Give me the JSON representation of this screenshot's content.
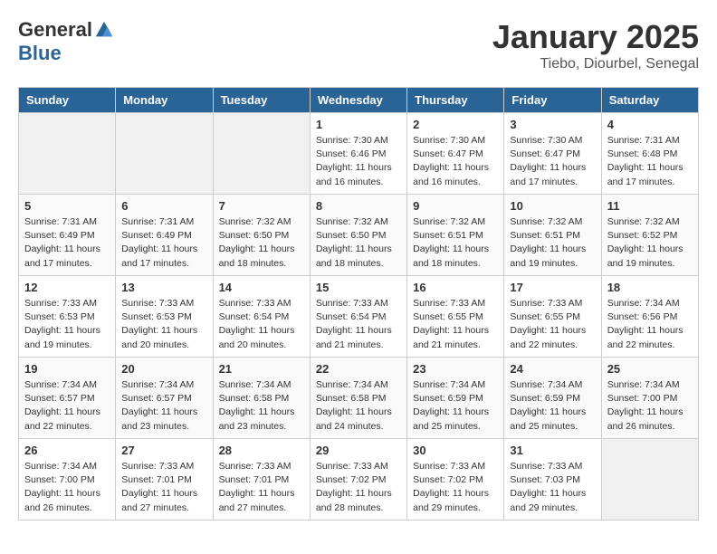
{
  "header": {
    "logo_general": "General",
    "logo_blue": "Blue",
    "title": "January 2025",
    "subtitle": "Tiebo, Diourbel, Senegal"
  },
  "days_of_week": [
    "Sunday",
    "Monday",
    "Tuesday",
    "Wednesday",
    "Thursday",
    "Friday",
    "Saturday"
  ],
  "weeks": [
    [
      {
        "day": "",
        "info": ""
      },
      {
        "day": "",
        "info": ""
      },
      {
        "day": "",
        "info": ""
      },
      {
        "day": "1",
        "info": "Sunrise: 7:30 AM\nSunset: 6:46 PM\nDaylight: 11 hours and 16 minutes."
      },
      {
        "day": "2",
        "info": "Sunrise: 7:30 AM\nSunset: 6:47 PM\nDaylight: 11 hours and 16 minutes."
      },
      {
        "day": "3",
        "info": "Sunrise: 7:30 AM\nSunset: 6:47 PM\nDaylight: 11 hours and 17 minutes."
      },
      {
        "day": "4",
        "info": "Sunrise: 7:31 AM\nSunset: 6:48 PM\nDaylight: 11 hours and 17 minutes."
      }
    ],
    [
      {
        "day": "5",
        "info": "Sunrise: 7:31 AM\nSunset: 6:49 PM\nDaylight: 11 hours and 17 minutes."
      },
      {
        "day": "6",
        "info": "Sunrise: 7:31 AM\nSunset: 6:49 PM\nDaylight: 11 hours and 17 minutes."
      },
      {
        "day": "7",
        "info": "Sunrise: 7:32 AM\nSunset: 6:50 PM\nDaylight: 11 hours and 18 minutes."
      },
      {
        "day": "8",
        "info": "Sunrise: 7:32 AM\nSunset: 6:50 PM\nDaylight: 11 hours and 18 minutes."
      },
      {
        "day": "9",
        "info": "Sunrise: 7:32 AM\nSunset: 6:51 PM\nDaylight: 11 hours and 18 minutes."
      },
      {
        "day": "10",
        "info": "Sunrise: 7:32 AM\nSunset: 6:51 PM\nDaylight: 11 hours and 19 minutes."
      },
      {
        "day": "11",
        "info": "Sunrise: 7:32 AM\nSunset: 6:52 PM\nDaylight: 11 hours and 19 minutes."
      }
    ],
    [
      {
        "day": "12",
        "info": "Sunrise: 7:33 AM\nSunset: 6:53 PM\nDaylight: 11 hours and 19 minutes."
      },
      {
        "day": "13",
        "info": "Sunrise: 7:33 AM\nSunset: 6:53 PM\nDaylight: 11 hours and 20 minutes."
      },
      {
        "day": "14",
        "info": "Sunrise: 7:33 AM\nSunset: 6:54 PM\nDaylight: 11 hours and 20 minutes."
      },
      {
        "day": "15",
        "info": "Sunrise: 7:33 AM\nSunset: 6:54 PM\nDaylight: 11 hours and 21 minutes."
      },
      {
        "day": "16",
        "info": "Sunrise: 7:33 AM\nSunset: 6:55 PM\nDaylight: 11 hours and 21 minutes."
      },
      {
        "day": "17",
        "info": "Sunrise: 7:33 AM\nSunset: 6:55 PM\nDaylight: 11 hours and 22 minutes."
      },
      {
        "day": "18",
        "info": "Sunrise: 7:34 AM\nSunset: 6:56 PM\nDaylight: 11 hours and 22 minutes."
      }
    ],
    [
      {
        "day": "19",
        "info": "Sunrise: 7:34 AM\nSunset: 6:57 PM\nDaylight: 11 hours and 22 minutes."
      },
      {
        "day": "20",
        "info": "Sunrise: 7:34 AM\nSunset: 6:57 PM\nDaylight: 11 hours and 23 minutes."
      },
      {
        "day": "21",
        "info": "Sunrise: 7:34 AM\nSunset: 6:58 PM\nDaylight: 11 hours and 23 minutes."
      },
      {
        "day": "22",
        "info": "Sunrise: 7:34 AM\nSunset: 6:58 PM\nDaylight: 11 hours and 24 minutes."
      },
      {
        "day": "23",
        "info": "Sunrise: 7:34 AM\nSunset: 6:59 PM\nDaylight: 11 hours and 25 minutes."
      },
      {
        "day": "24",
        "info": "Sunrise: 7:34 AM\nSunset: 6:59 PM\nDaylight: 11 hours and 25 minutes."
      },
      {
        "day": "25",
        "info": "Sunrise: 7:34 AM\nSunset: 7:00 PM\nDaylight: 11 hours and 26 minutes."
      }
    ],
    [
      {
        "day": "26",
        "info": "Sunrise: 7:34 AM\nSunset: 7:00 PM\nDaylight: 11 hours and 26 minutes."
      },
      {
        "day": "27",
        "info": "Sunrise: 7:33 AM\nSunset: 7:01 PM\nDaylight: 11 hours and 27 minutes."
      },
      {
        "day": "28",
        "info": "Sunrise: 7:33 AM\nSunset: 7:01 PM\nDaylight: 11 hours and 27 minutes."
      },
      {
        "day": "29",
        "info": "Sunrise: 7:33 AM\nSunset: 7:02 PM\nDaylight: 11 hours and 28 minutes."
      },
      {
        "day": "30",
        "info": "Sunrise: 7:33 AM\nSunset: 7:02 PM\nDaylight: 11 hours and 29 minutes."
      },
      {
        "day": "31",
        "info": "Sunrise: 7:33 AM\nSunset: 7:03 PM\nDaylight: 11 hours and 29 minutes."
      },
      {
        "day": "",
        "info": ""
      }
    ]
  ]
}
